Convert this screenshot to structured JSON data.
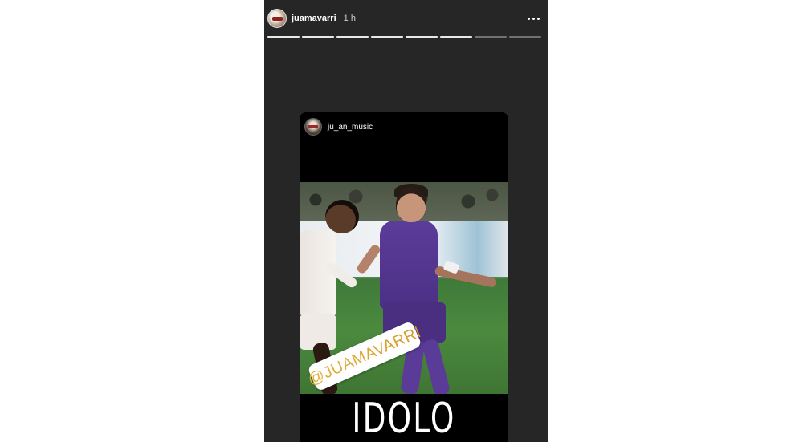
{
  "story": {
    "username": "juamavarri",
    "timestamp": "1 h",
    "segments": [
      {
        "progress": 1.0
      },
      {
        "progress": 1.0
      },
      {
        "progress": 1.0
      },
      {
        "progress": 1.0
      },
      {
        "progress": 1.0
      },
      {
        "progress": 1.0
      },
      {
        "progress": 0.0
      },
      {
        "progress": 0.0
      }
    ]
  },
  "shared_post": {
    "username": "ju_an_music",
    "mention": "@JUAMAVARRI",
    "caption": "IDOLO"
  },
  "colors": {
    "story_background": "#262626",
    "post_background": "#000000",
    "mention_text": "#d9a430"
  },
  "icons": {
    "more_options": "more-horizontal-icon"
  }
}
